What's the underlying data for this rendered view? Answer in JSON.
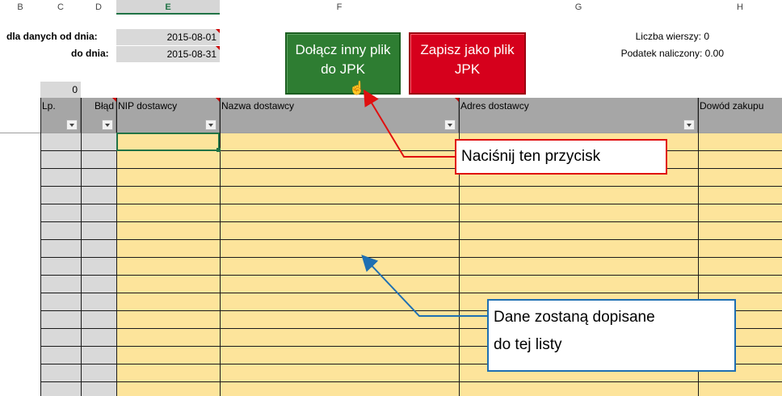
{
  "columns": [
    "B",
    "C",
    "D",
    "E",
    "F",
    "G",
    "H"
  ],
  "filters": {
    "from_label": "dla danych od dnia:",
    "from_value": "2015-08-01",
    "to_label": "do dnia:",
    "to_value": "2015-08-31"
  },
  "buttons": {
    "append_label": "Dołącz inny plik do JPK",
    "save_label": "Zapisz jako plik JPK"
  },
  "info": {
    "rows_label": "Liczba wierszy: 0",
    "tax_label": "Podatek naliczony: 0.00"
  },
  "row_count": "0",
  "table": {
    "headers": [
      "Lp.",
      "Błąd",
      "NIP dostawcy",
      "Nazwa dostawcy",
      "Adres dostawcy",
      "Dowód zakupu"
    ]
  },
  "callouts": {
    "press_button": "Naciśnij ten przycisk",
    "data_appended_1": "Dane zostaną dopisane",
    "data_appended_2": "do tej listy"
  },
  "colors": {
    "green_button": "#2e7d32",
    "red_button": "#d6001c",
    "header_fill": "#a6a6a6",
    "input_fill": "#fde49b",
    "red_arrow": "#e01010",
    "blue_arrow": "#1f6fb2"
  }
}
